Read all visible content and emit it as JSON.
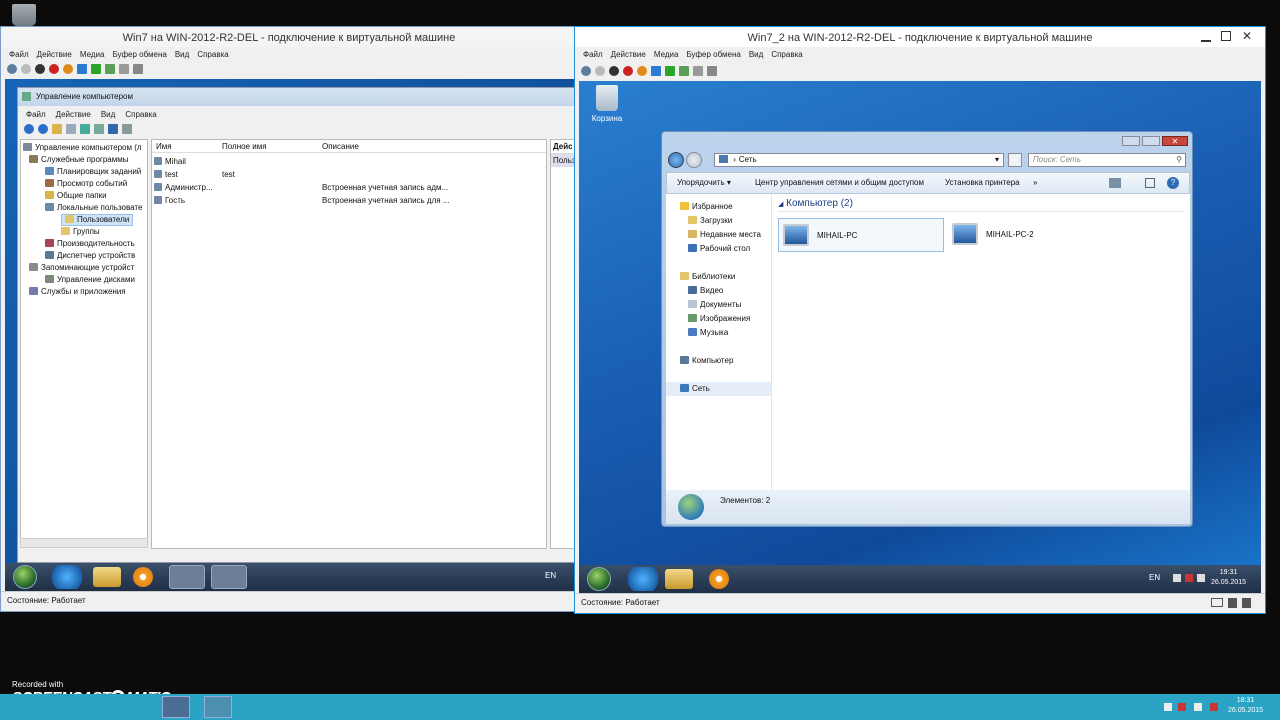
{
  "host": {
    "recycle_bin": "",
    "screencast": {
      "recorded_with": "Recorded with",
      "brand": "SCREENCAST",
      "brand2": "MATIC"
    },
    "clock": {
      "time": "18:31",
      "date": "26.05.2015"
    }
  },
  "vm1": {
    "title": "Win7 на WIN-2012-R2-DEL - подключение к виртуальной машине",
    "menu": [
      "Файл",
      "Действие",
      "Медиа",
      "Буфер обмена",
      "Вид",
      "Справка"
    ],
    "status": "Состояние: Работает",
    "lang": "EN",
    "mmc": {
      "title": "Управление компьютером",
      "menu": [
        "Файл",
        "Действие",
        "Вид",
        "Справка"
      ],
      "tree": [
        "Управление компьютером (л",
        "Служебные программы",
        "Планировщик заданий",
        "Просмотр событий",
        "Общие папки",
        "Локальные пользовате",
        "Пользователи",
        "Группы",
        "Производительность",
        "Диспетчер устройств",
        "Запоминающие устройст",
        "Управление дисками",
        "Службы и приложения"
      ],
      "columns": [
        "Имя",
        "Полное имя",
        "Описание"
      ],
      "rows": [
        {
          "name": "Mihail",
          "full": "",
          "desc": ""
        },
        {
          "name": "test",
          "full": "test",
          "desc": ""
        },
        {
          "name": "Администр...",
          "full": "",
          "desc": "Встроенная учетная запись адм..."
        },
        {
          "name": "Гость",
          "full": "",
          "desc": "Встроенная учетная запись для ..."
        }
      ],
      "actions_header": "Дейс",
      "actions_item": "Польз"
    }
  },
  "vm2": {
    "title": "Win7_2 на WIN-2012-R2-DEL - подключение к виртуальной машине",
    "menu": [
      "Файл",
      "Действие",
      "Медиа",
      "Буфер обмена",
      "Вид",
      "Справка"
    ],
    "status": "Состояние: Работает",
    "desktop_icon": "Корзина",
    "lang": "EN",
    "clock": {
      "time": "19:31",
      "date": "26.05.2015"
    },
    "explorer": {
      "address": "Сеть",
      "search_placeholder": "Поиск: Сеть",
      "toolbar": [
        "Упорядочить",
        "Центр управления сетями и общим доступом",
        "Установка принтера",
        "»"
      ],
      "nav": {
        "favorites": "Избранное",
        "fav_items": [
          "Загрузки",
          "Недавние места",
          "Рабочий стол"
        ],
        "libraries": "Библиотеки",
        "lib_items": [
          "Видео",
          "Документы",
          "Изображения",
          "Музыка"
        ],
        "computer": "Компьютер",
        "network": "Сеть"
      },
      "group_header": "Компьютер (2)",
      "computers": [
        "MIHAIL-PC",
        "MIHAIL-PC-2"
      ],
      "items_count": "Элементов: 2"
    }
  }
}
